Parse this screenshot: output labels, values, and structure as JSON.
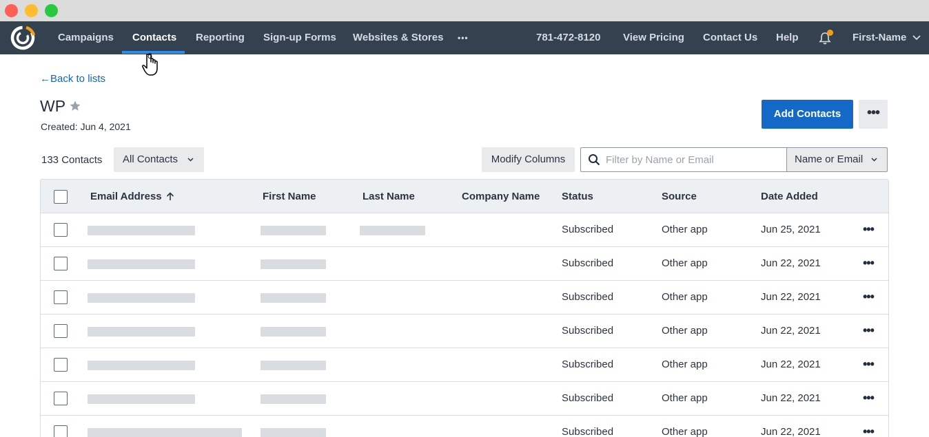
{
  "nav": {
    "items": [
      "Campaigns",
      "Contacts",
      "Reporting",
      "Sign-up Forms",
      "Websites & Stores"
    ],
    "more": "•••",
    "phone": "781-472-8120",
    "view_pricing": "View Pricing",
    "contact_us": "Contact Us",
    "help": "Help",
    "user": "First-Name",
    "active": "Contacts",
    "accent_color": "#2e8cf0"
  },
  "page": {
    "back_link": "Back to lists",
    "title": "WP",
    "created": "Created: Jun 4, 2021",
    "add_contacts": "Add Contacts",
    "contacts_count": "133 Contacts",
    "filter_dropdown": "All Contacts",
    "modify_columns": "Modify Columns",
    "search_placeholder": "Filter by Name or Email",
    "search_type": "Name or Email"
  },
  "table": {
    "columns": [
      "Email Address",
      "First Name",
      "Last Name",
      "Company Name",
      "Status",
      "Source",
      "Date Added"
    ],
    "rows": [
      {
        "status": "Subscribed",
        "source": "Other app",
        "date": "Jun 25, 2021"
      },
      {
        "status": "Subscribed",
        "source": "Other app",
        "date": "Jun 22, 2021"
      },
      {
        "status": "Subscribed",
        "source": "Other app",
        "date": "Jun 22, 2021"
      },
      {
        "status": "Subscribed",
        "source": "Other app",
        "date": "Jun 22, 2021"
      },
      {
        "status": "Subscribed",
        "source": "Other app",
        "date": "Jun 22, 2021"
      },
      {
        "status": "Subscribed",
        "source": "Other app",
        "date": "Jun 22, 2021"
      },
      {
        "status": "Subscribed",
        "source": "Other app",
        "date": "Jun 22, 2021"
      }
    ]
  }
}
